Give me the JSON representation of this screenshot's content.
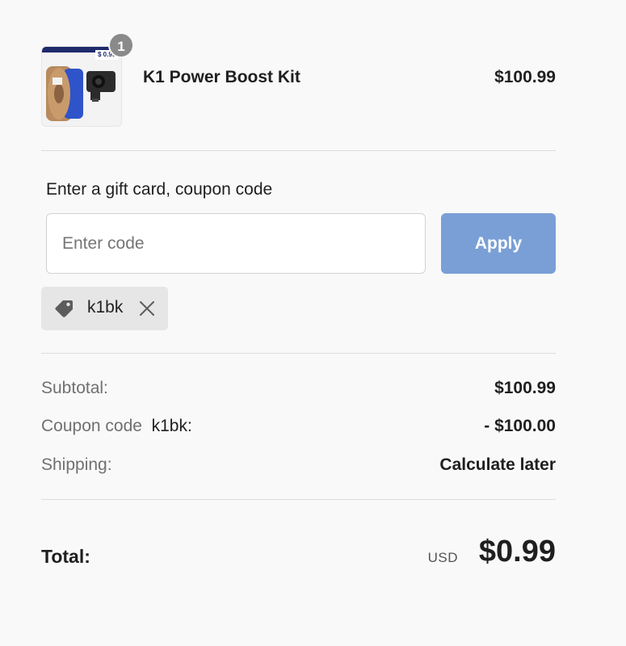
{
  "cart": {
    "item": {
      "quantity": "1",
      "name": "K1 Power Boost Kit",
      "price": "$100.99",
      "thumb_price_tag": "$ 0.99"
    }
  },
  "coupon": {
    "label": "Enter a gift card, coupon code",
    "input_placeholder": "Enter code",
    "input_value": "",
    "apply_label": "Apply",
    "applied_code": "k1bk"
  },
  "summary": {
    "subtotal_label": "Subtotal:",
    "subtotal_value": "$100.99",
    "coupon_label": "Coupon code",
    "coupon_code": "k1bk:",
    "coupon_value": "- $100.00",
    "shipping_label": "Shipping:",
    "shipping_value": "Calculate later"
  },
  "total": {
    "label": "Total:",
    "currency": "USD",
    "value": "$0.99"
  },
  "colors": {
    "accent_button": "#7a9fd6",
    "badge": "#8a8a8a",
    "chip_background": "#e6e6e6",
    "spool_blue": "#2f54c9"
  },
  "icons": {
    "chip_tag": "tag-icon",
    "chip_remove": "close-icon"
  }
}
